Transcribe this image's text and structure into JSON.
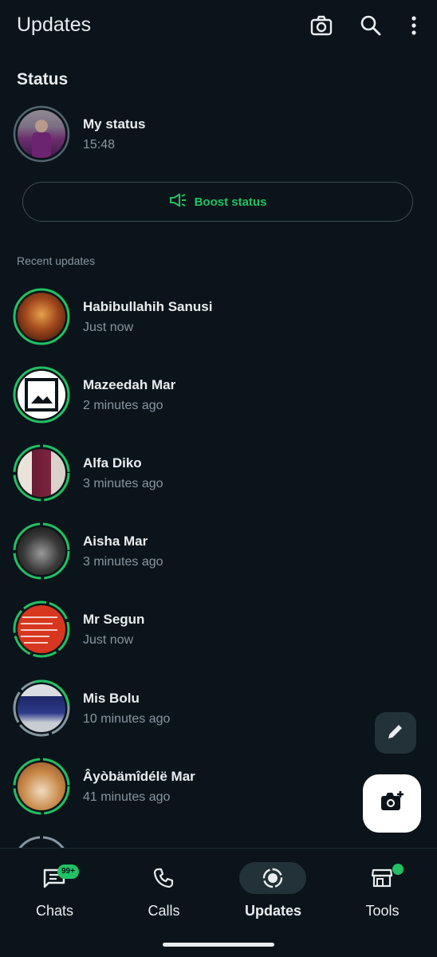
{
  "header": {
    "title": "Updates",
    "icons": [
      "camera-icon",
      "search-icon",
      "more-vertical-icon"
    ]
  },
  "status_section": {
    "title": "Status",
    "my_status": {
      "name": "My status",
      "time": "15:48"
    },
    "boost_label": "Boost status",
    "recent_label": "Recent updates"
  },
  "updates": [
    {
      "name": "Habibullahih Sanusi",
      "time": "Just now"
    },
    {
      "name": "Mazeedah Mar",
      "time": "2 minutes ago"
    },
    {
      "name": "Alfa Diko",
      "time": "3 minutes ago"
    },
    {
      "name": "Aisha Mar",
      "time": "3 minutes ago"
    },
    {
      "name": "Mr Segun",
      "time": "Just now"
    },
    {
      "name": "Mis Bolu",
      "time": "10 minutes ago"
    },
    {
      "name": "Âyòbämîdélë Mar",
      "time": "41 minutes ago"
    }
  ],
  "nav": {
    "items": [
      {
        "label": "Chats",
        "badge": "99+"
      },
      {
        "label": "Calls"
      },
      {
        "label": "Updates",
        "active": true
      },
      {
        "label": "Tools",
        "dot": true
      }
    ]
  },
  "colors": {
    "accent": "#21c063",
    "background": "#0b141a",
    "muted": "#8696a0"
  }
}
